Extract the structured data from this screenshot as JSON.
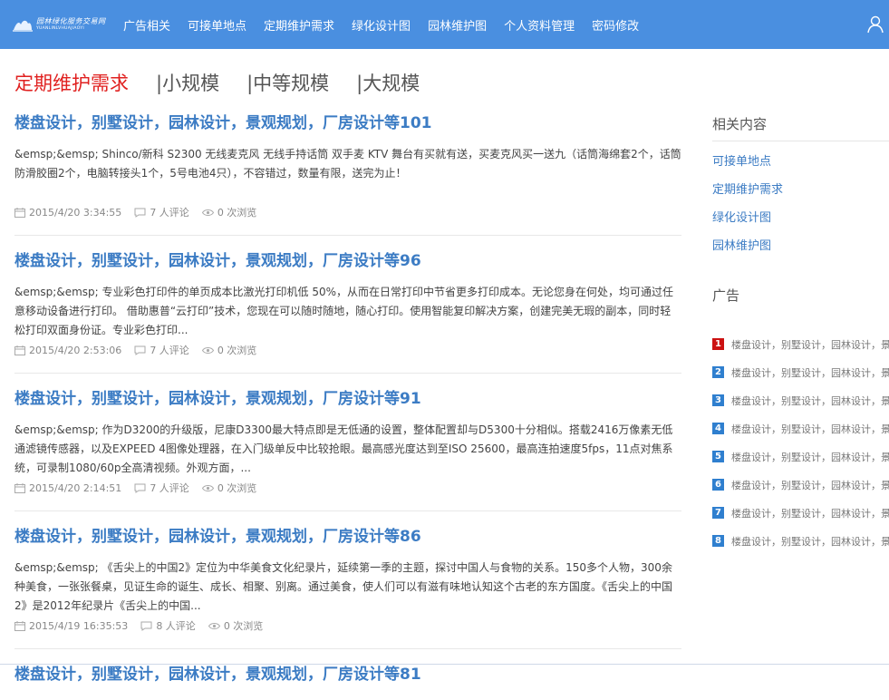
{
  "nav": {
    "logo_cn": "园林绿化服务交易网",
    "logo_en": "YUANLINLVHUAJIAOYI",
    "items": [
      "广告相关",
      "可接单地点",
      "定期维护需求",
      "绿化设计图",
      "园林维护图",
      "个人资料管理",
      "密码修改"
    ],
    "user_icon": "user-icon"
  },
  "categories": {
    "active": "定期维护需求",
    "others": [
      "|小规模",
      "|中等规模",
      "|大规模"
    ]
  },
  "posts": [
    {
      "title": "楼盘设计，别墅设计，园林设计，景观规划，厂房设计等101",
      "excerpt": "&emsp;&emsp; Shinco/新科 S2300 无线麦克风 无线手持话筒 双手麦 KTV 舞台有买就有送，买麦克风买一送九（话筒海绵套2个，话筒防滑胶圈2个，电脑转接头1个，5号电池4只），不容错过，数量有限，送完为止！",
      "date": "2015/4/20 3:34:55",
      "comments": "7 人评论",
      "views": "0 次浏览"
    },
    {
      "title": "楼盘设计，别墅设计，园林设计，景观规划，厂房设计等96",
      "excerpt": "&emsp;&emsp; 专业彩色打印件的单页成本比激光打印机低 50%，从而在日常打印中节省更多打印成本。无论您身在何处，均可通过任意移动设备进行打印。 借助惠普“云打印”技术，您现在可以随时随地，随心打印。使用智能复印解决方案，创建完美无瑕的副本，同时轻松打印双面身份证。专业彩色打印...",
      "date": "2015/4/20 2:53:06",
      "comments": "7 人评论",
      "views": "0 次浏览"
    },
    {
      "title": "楼盘设计，别墅设计，园林设计，景观规划，厂房设计等91",
      "excerpt": "&emsp;&emsp; 作为D3200的升级版，尼康D3300最大特点即是无低通的设置，整体配置却与D5300十分相似。搭载2416万像素无低通滤镜传感器，以及EXPEED 4图像处理器，在入门级单反中比较抢眼。最高感光度达到至ISO 25600，最高连拍速度5fps，11点对焦系统，可录制1080/60p全高清视频。外观方面，...",
      "date": "2015/4/20 2:14:51",
      "comments": "7 人评论",
      "views": "0 次浏览"
    },
    {
      "title": "楼盘设计，别墅设计，园林设计，景观规划，厂房设计等86",
      "excerpt": "&emsp;&emsp; 《舌尖上的中国2》定位为中华美食文化纪录片，延续第一季的主题，探讨中国人与食物的关系。150多个人物，300余种美食，一张张餐桌，见证生命的诞生、成长、相聚、别离。通过美食，使人们可以有滋有味地认知这个古老的东方国度。《舌尖上的中国2》是2012年纪录片《舌尖上的中国...",
      "date": "2015/4/19 16:35:53",
      "comments": "8 人评论",
      "views": "0 次浏览"
    },
    {
      "title": "楼盘设计，别墅设计，园林设计，景观规划，厂房设计等81",
      "excerpt": "",
      "date": "",
      "comments": "",
      "views": ""
    }
  ],
  "sidebar": {
    "related_title": "相关内容",
    "related": [
      "可接单地点",
      "定期维护需求",
      "绿化设计图",
      "园林维护图"
    ],
    "ad_title": "广告",
    "ads": [
      {
        "num": "1",
        "text": "楼盘设计，别墅设计，园林设计，景"
      },
      {
        "num": "2",
        "text": "楼盘设计，别墅设计，园林设计，景"
      },
      {
        "num": "3",
        "text": "楼盘设计，别墅设计，园林设计，景"
      },
      {
        "num": "4",
        "text": "楼盘设计，别墅设计，园林设计，景"
      },
      {
        "num": "5",
        "text": "楼盘设计，别墅设计，园林设计，景"
      },
      {
        "num": "6",
        "text": "楼盘设计，别墅设计，园林设计，景"
      },
      {
        "num": "7",
        "text": "楼盘设计，别墅设计，园林设计，景"
      },
      {
        "num": "8",
        "text": "楼盘设计，别墅设计，园林设计，景"
      }
    ]
  },
  "colors": {
    "nav_bg": "#4a8fe0",
    "title_blue": "#3c7cc4",
    "active_red": "#e0201f",
    "ad_first": "#cc1111",
    "ad_rest": "#2f7fcf"
  }
}
